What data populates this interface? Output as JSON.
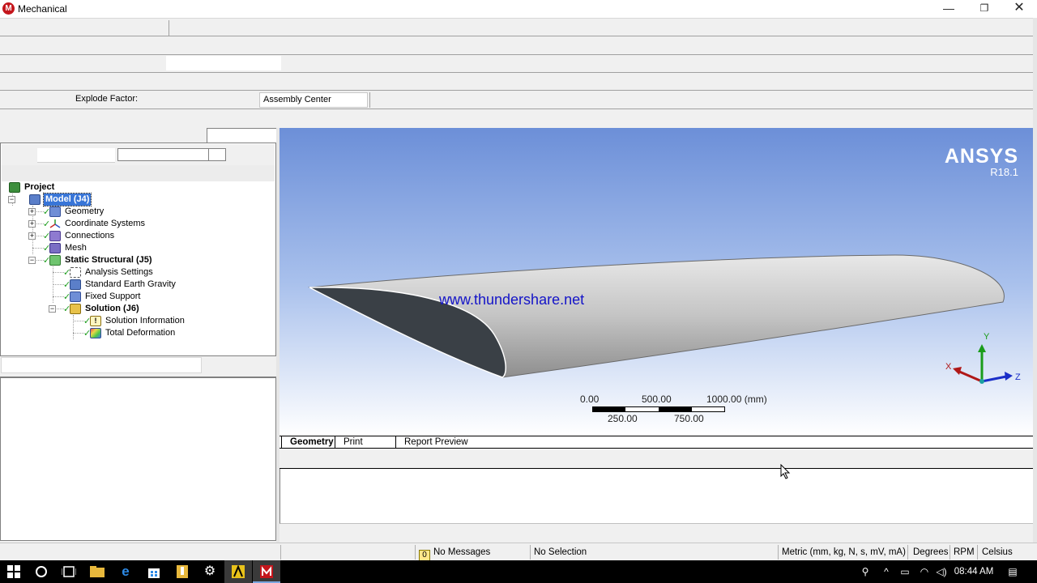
{
  "window": {
    "title": "Mechanical",
    "app_icon_letter": "M",
    "minimize": "—",
    "maximize": "❐",
    "close": "✕"
  },
  "toolbar": {
    "explode_factor_label": "Explode Factor:",
    "explode_center_value": "Assembly Center"
  },
  "tree": {
    "project": "Project",
    "model": "Model (J4)",
    "geometry": "Geometry",
    "coordinate_systems": "Coordinate Systems",
    "connections": "Connections",
    "mesh": "Mesh",
    "static_structural": "Static Structural (J5)",
    "analysis_settings": "Analysis Settings",
    "earth_gravity": "Standard Earth Gravity",
    "fixed_support": "Fixed Support",
    "solution": "Solution (J6)",
    "solution_information": "Solution Information",
    "total_deformation": "Total Deformation"
  },
  "viewport": {
    "brand": "ANSYS",
    "version": "R18.1",
    "watermark": "www.thundershare.net",
    "scale": {
      "top_labels": [
        "0.00",
        "500.00",
        "1000.00 (mm)"
      ],
      "bottom_labels": [
        "250.00",
        "750.00"
      ]
    },
    "triad": {
      "x": "X",
      "y": "Y",
      "z": "Z"
    },
    "colors": {
      "background_top": "#6c8fd8",
      "background_bottom": "#ffffff",
      "body": "#c8c8c8",
      "end_face": "#3a4046"
    }
  },
  "view_tabs": [
    "Geometry",
    "Print Preview",
    "Report Preview"
  ],
  "statusbar": {
    "messages_count": "0",
    "messages": "No Messages",
    "selection": "No Selection",
    "units": "Metric (mm, kg, N, s, mV, mA)",
    "angle": "Degrees",
    "rotational": "RPM",
    "temperature": "Celsius"
  },
  "taskbar": {
    "clock": "08:44 AM"
  }
}
